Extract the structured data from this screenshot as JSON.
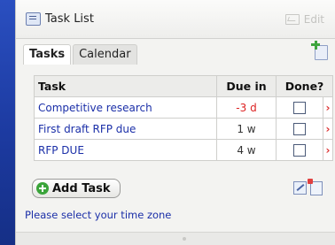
{
  "window": {
    "title": "Task List",
    "edit_label": "Edit"
  },
  "tabs": [
    {
      "label": "Tasks",
      "active": true
    },
    {
      "label": "Calendar",
      "active": false
    }
  ],
  "table": {
    "headers": {
      "task": "Task",
      "due": "Due in",
      "done": "Done?"
    },
    "rows": [
      {
        "task": "Competitive research",
        "due": "-3 d",
        "overdue": true,
        "done": false
      },
      {
        "task": "First draft RFP due",
        "due": "1 w",
        "overdue": false,
        "done": false
      },
      {
        "task": "RFP DUE",
        "due": "4 w",
        "overdue": false,
        "done": false
      }
    ],
    "delete_glyph": "›"
  },
  "actions": {
    "add_task_label": "Add Task"
  },
  "footer": {
    "timezone_link": "Please select your time zone"
  },
  "icons": {
    "title": "task-list-icon",
    "edit": "edit-icon",
    "new": "new-task-icon",
    "add": "plus-circle-icon",
    "edit_small": "pencil-icon",
    "doc_small": "document-icon",
    "delete": "delete-x-icon"
  },
  "colors": {
    "link": "#1b2fa8",
    "overdue": "#dd2222",
    "delete": "#dd3333",
    "add_green": "#3aa43a",
    "background_blue": "#1f3d9e"
  }
}
